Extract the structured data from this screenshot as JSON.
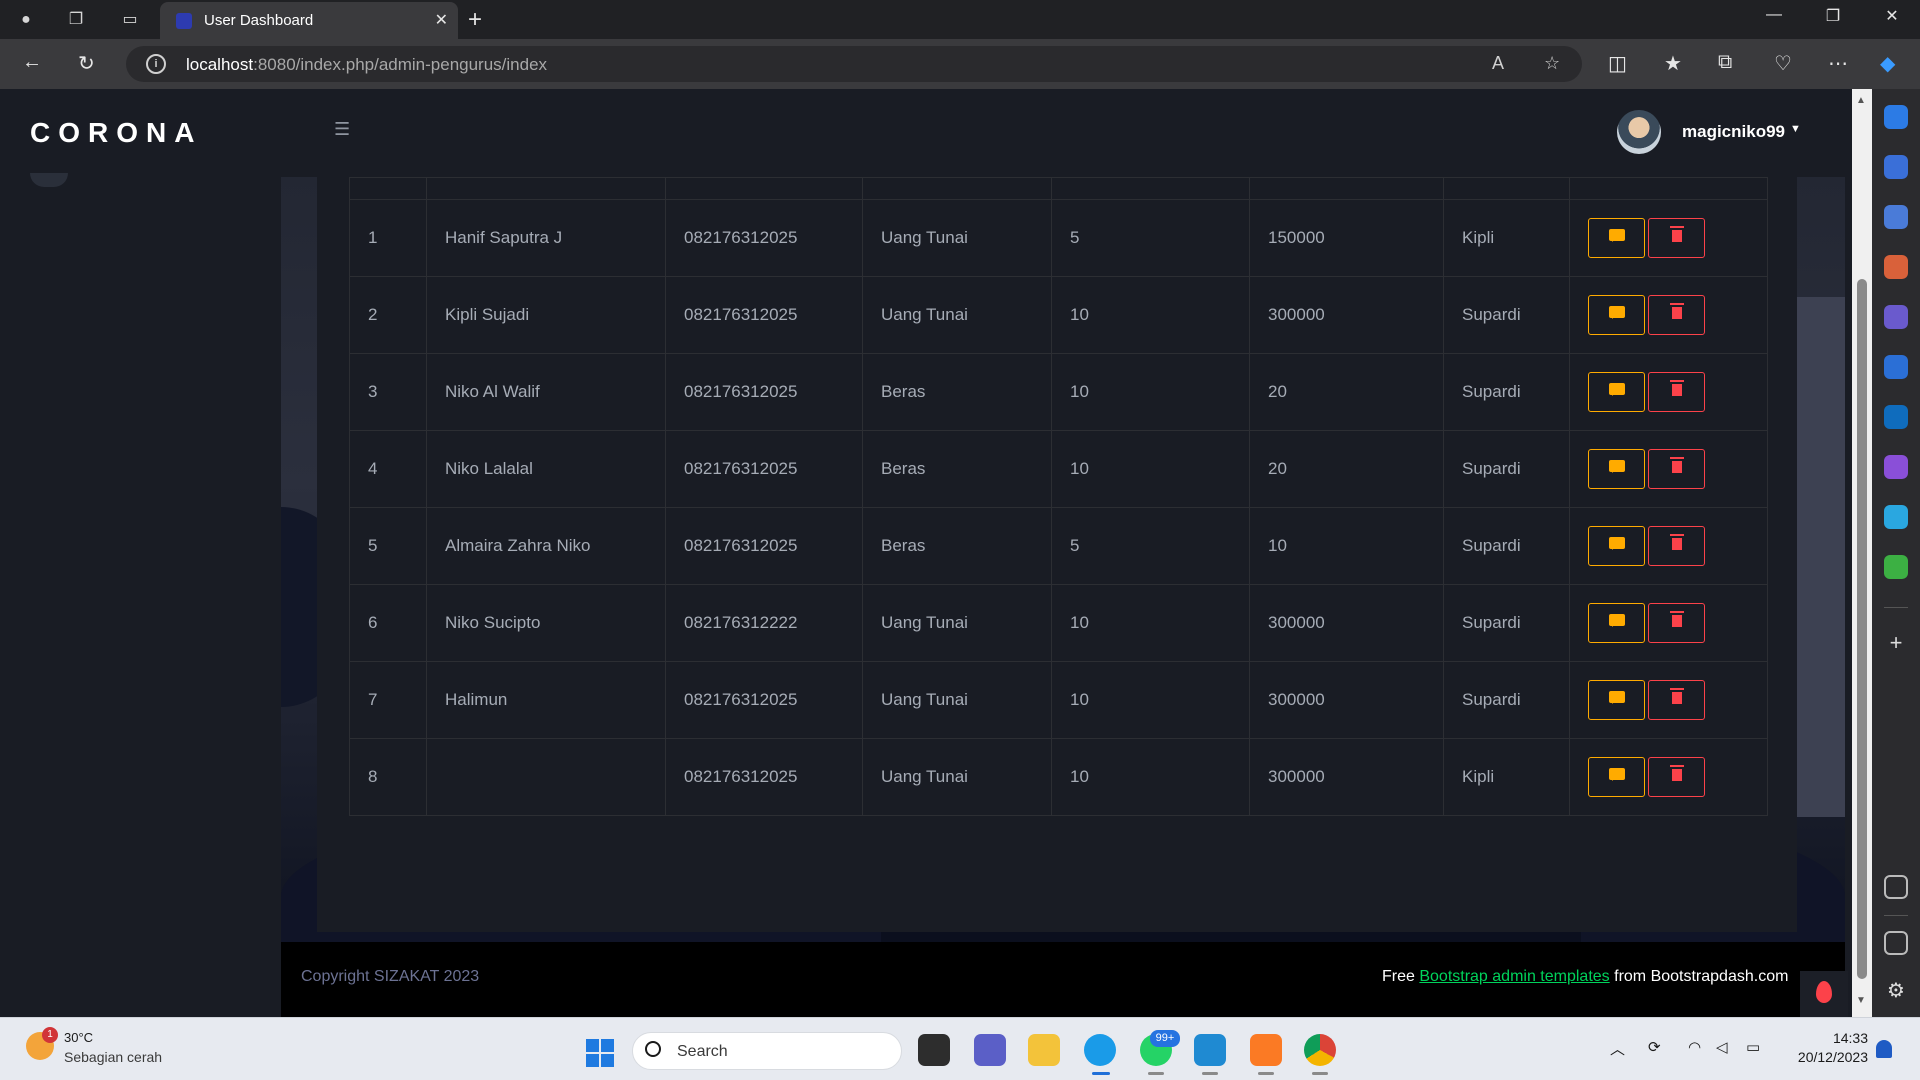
{
  "browser": {
    "tab_title": "User Dashboard",
    "url_host": "localhost",
    "url_path": ":8080/index.php/admin-pengurus/index"
  },
  "app": {
    "brand": "CORONA",
    "username": "magicniko99"
  },
  "table": {
    "rows": [
      {
        "no": "1",
        "name": "Hanif Saputra J",
        "phone": "082176312025",
        "type": "Uang Tunai",
        "jiwa": "5",
        "amount": "150000",
        "officer": "Kipli"
      },
      {
        "no": "2",
        "name": "Kipli Sujadi",
        "phone": "082176312025",
        "type": "Uang Tunai",
        "jiwa": "10",
        "amount": "300000",
        "officer": "Supardi"
      },
      {
        "no": "3",
        "name": "Niko Al Walif",
        "phone": "082176312025",
        "type": "Beras",
        "jiwa": "10",
        "amount": "20",
        "officer": "Supardi"
      },
      {
        "no": "4",
        "name": "Niko Lalalal",
        "phone": "082176312025",
        "type": "Beras",
        "jiwa": "10",
        "amount": "20",
        "officer": "Supardi"
      },
      {
        "no": "5",
        "name": "Almaira Zahra Niko",
        "phone": "082176312025",
        "type": "Beras",
        "jiwa": "5",
        "amount": "10",
        "officer": "Supardi"
      },
      {
        "no": "6",
        "name": "Niko Sucipto",
        "phone": "082176312222",
        "type": "Uang Tunai",
        "jiwa": "10",
        "amount": "300000",
        "officer": "Supardi"
      },
      {
        "no": "7",
        "name": "Halimun",
        "phone": "082176312025",
        "type": "Uang Tunai",
        "jiwa": "10",
        "amount": "300000",
        "officer": "Supardi"
      },
      {
        "no": "8",
        "name": "",
        "phone": "082176312025",
        "type": "Uang Tunai",
        "jiwa": "10",
        "amount": "300000",
        "officer": "Kipli"
      }
    ]
  },
  "footer": {
    "copyright": "Copyright SIZAKAT 2023",
    "free_prefix": "Free ",
    "link_text": "Bootstrap admin templates",
    "free_suffix": " from Bootstrapdash.com"
  },
  "taskbar": {
    "temperature": "30°C",
    "condition": "Sebagian cerah",
    "weather_badge": "1",
    "search_label": "Search",
    "whatsapp_badge": "99+",
    "time": "14:33",
    "date": "20/12/2023"
  },
  "colors": {
    "edit_accent": "#ffab00",
    "delete_accent": "#fc424a",
    "link_green": "#00d25b",
    "page_bg": "#191c24"
  }
}
